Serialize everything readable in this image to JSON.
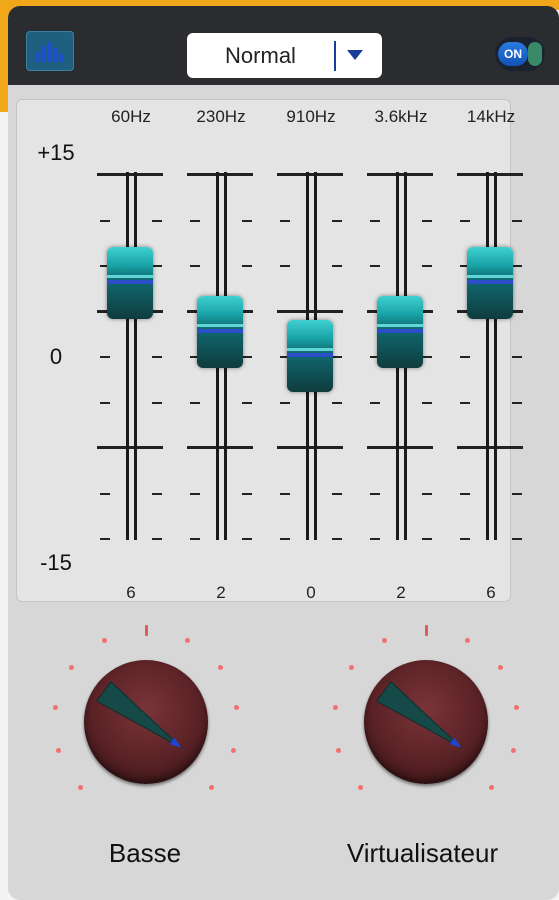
{
  "header": {
    "preset": {
      "selected": "Normal"
    },
    "power_toggle": {
      "label": "ON",
      "state": "on"
    },
    "icons": {
      "equalizer": "equalizer-bars-icon",
      "dropdown": "triangle-down-icon"
    }
  },
  "equalizer": {
    "scale": {
      "max": "+15",
      "mid": "0",
      "min": "-15"
    },
    "bands": [
      {
        "freq": "60Hz",
        "value": "6",
        "level": 6
      },
      {
        "freq": "230Hz",
        "value": "2",
        "level": 2
      },
      {
        "freq": "910Hz",
        "value": "0",
        "level": 0
      },
      {
        "freq": "3.6kHz",
        "value": "2",
        "level": 2
      },
      {
        "freq": "14kHz",
        "value": "6",
        "level": 6
      }
    ]
  },
  "effects": {
    "bass": {
      "label": "Basse",
      "level_fraction": 0.3
    },
    "virtualizer": {
      "label": "Virtualisateur",
      "level_fraction": 0.3
    }
  },
  "colors": {
    "accent": "#f0a81a",
    "topbar": "#2b2c30",
    "slider": "#1aa4a8",
    "knob": "#5a2226",
    "knob_marks": "#f07070"
  }
}
